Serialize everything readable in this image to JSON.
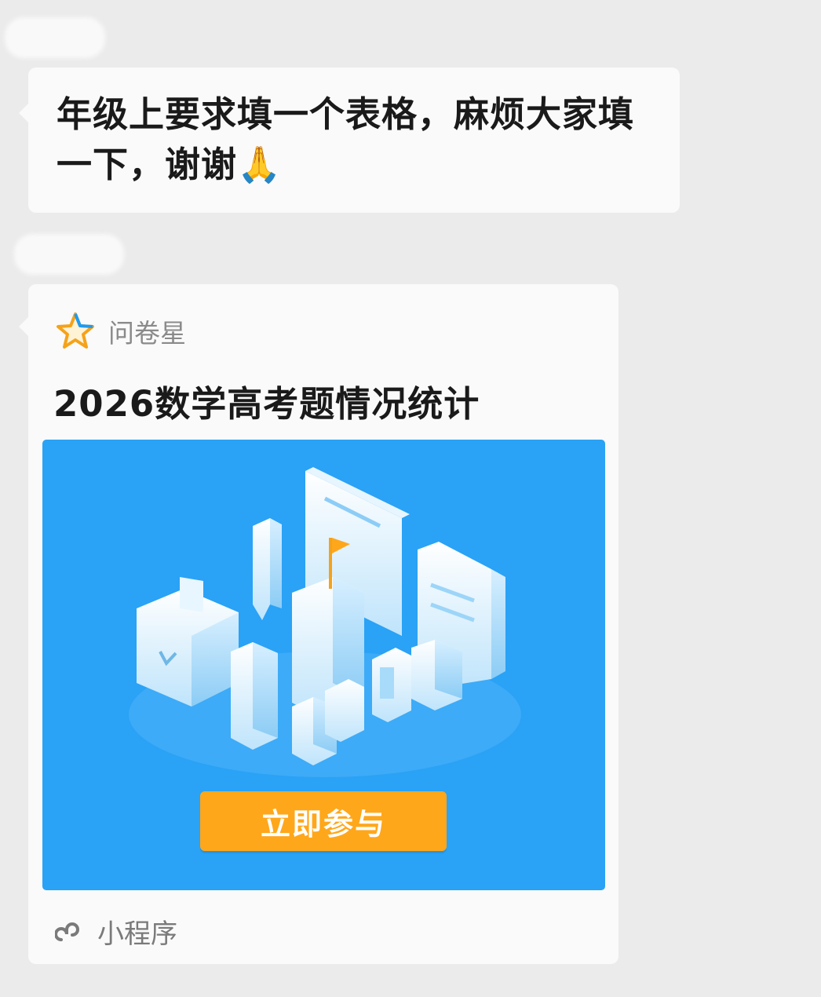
{
  "message": {
    "text": "年级上要求填一个表格，麻烦大家填一下，谢谢🙏"
  },
  "card": {
    "source_name": "问卷星",
    "source_icon": "star-icon",
    "title": "2026数学高考题情况统计",
    "join_label": "立即参与",
    "footer_label": "小程序",
    "footer_icon": "mini-program-icon",
    "colors": {
      "cover_background": "#2aa2f6",
      "join_button": "#ffa71a"
    }
  }
}
